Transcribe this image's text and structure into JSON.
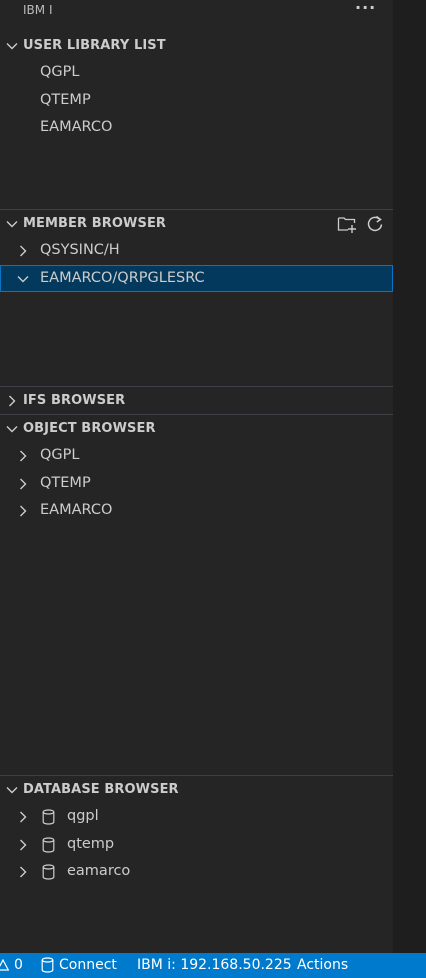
{
  "header": {
    "title": "IBM I",
    "more_label": "···"
  },
  "sections": {
    "user_library_list": {
      "title": "USER LIBRARY LIST",
      "items": [
        {
          "label": "QGPL"
        },
        {
          "label": "QTEMP"
        },
        {
          "label": "EAMARCO"
        }
      ]
    },
    "member_browser": {
      "title": "MEMBER BROWSER",
      "items": [
        {
          "label": "QSYSINC/H",
          "expanded": false
        },
        {
          "label": "EAMARCO/QRPGLESRC",
          "expanded": true,
          "selected": true
        }
      ]
    },
    "ifs_browser": {
      "title": "IFS BROWSER"
    },
    "object_browser": {
      "title": "OBJECT BROWSER",
      "items": [
        {
          "label": "QGPL"
        },
        {
          "label": "QTEMP"
        },
        {
          "label": "EAMARCO"
        }
      ]
    },
    "database_browser": {
      "title": "DATABASE BROWSER",
      "items": [
        {
          "label": "qgpl"
        },
        {
          "label": "qtemp"
        },
        {
          "label": "eamarco"
        }
      ]
    }
  },
  "statusbar": {
    "warnings": "0",
    "connect": "Connect",
    "connection": "IBM i: 192.168.50.225",
    "actions": "Actions"
  },
  "colors": {
    "statusbar": "#007acc",
    "selection": "#04395e",
    "selection_border": "#0a73c4"
  },
  "icons": [
    "chevron-down-icon",
    "chevron-right-icon",
    "new-folder-icon",
    "refresh-icon",
    "database-icon",
    "warning-icon"
  ]
}
